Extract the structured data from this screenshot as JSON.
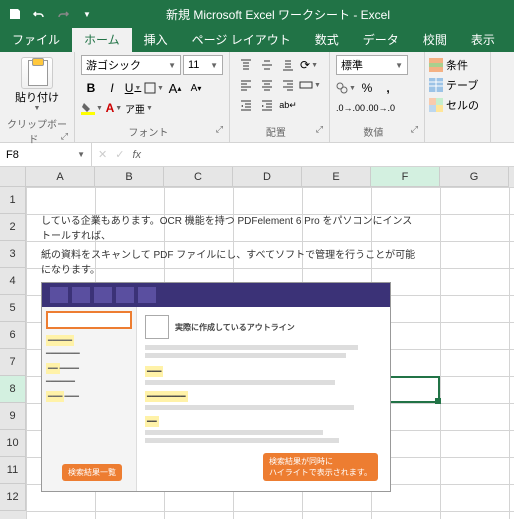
{
  "title": "新規 Microsoft Excel ワークシート - Excel",
  "tabs": [
    "ファイル",
    "ホーム",
    "挿入",
    "ページ レイアウト",
    "数式",
    "データ",
    "校閲",
    "表示"
  ],
  "active_tab": 1,
  "ribbon": {
    "clipboard": {
      "paste": "貼り付け",
      "label": "クリップボード"
    },
    "font": {
      "name": "游ゴシック",
      "size": "11",
      "label": "フォント",
      "bold": "B",
      "italic": "I",
      "underline": "U"
    },
    "alignment": {
      "label": "配置"
    },
    "number": {
      "format": "標準",
      "label": "数値"
    },
    "styles": {
      "cond": "条件",
      "table": "テーブ",
      "cell": "セルの"
    }
  },
  "namebox": "F8",
  "columns": [
    "A",
    "B",
    "C",
    "D",
    "E",
    "F",
    "G"
  ],
  "rows": [
    "1",
    "2",
    "3",
    "4",
    "5",
    "6",
    "7",
    "8",
    "9",
    "10",
    "11",
    "12"
  ],
  "selected_col": 5,
  "selected_row": 7,
  "content": {
    "line1": "している企業もあります。OCR 機能を持つ PDFelement 6 Pro をパソコンにインストールすれば、",
    "line2": "紙の資料をスキャンして PDF ファイルにし、すべてソフトで管理を行うことが可能になります。",
    "badge1": "検索結果一覧",
    "badge2": "検索結果が同時に\nハイライトで表示されます。",
    "embed_title": "実際に作成しているアウトライン"
  }
}
